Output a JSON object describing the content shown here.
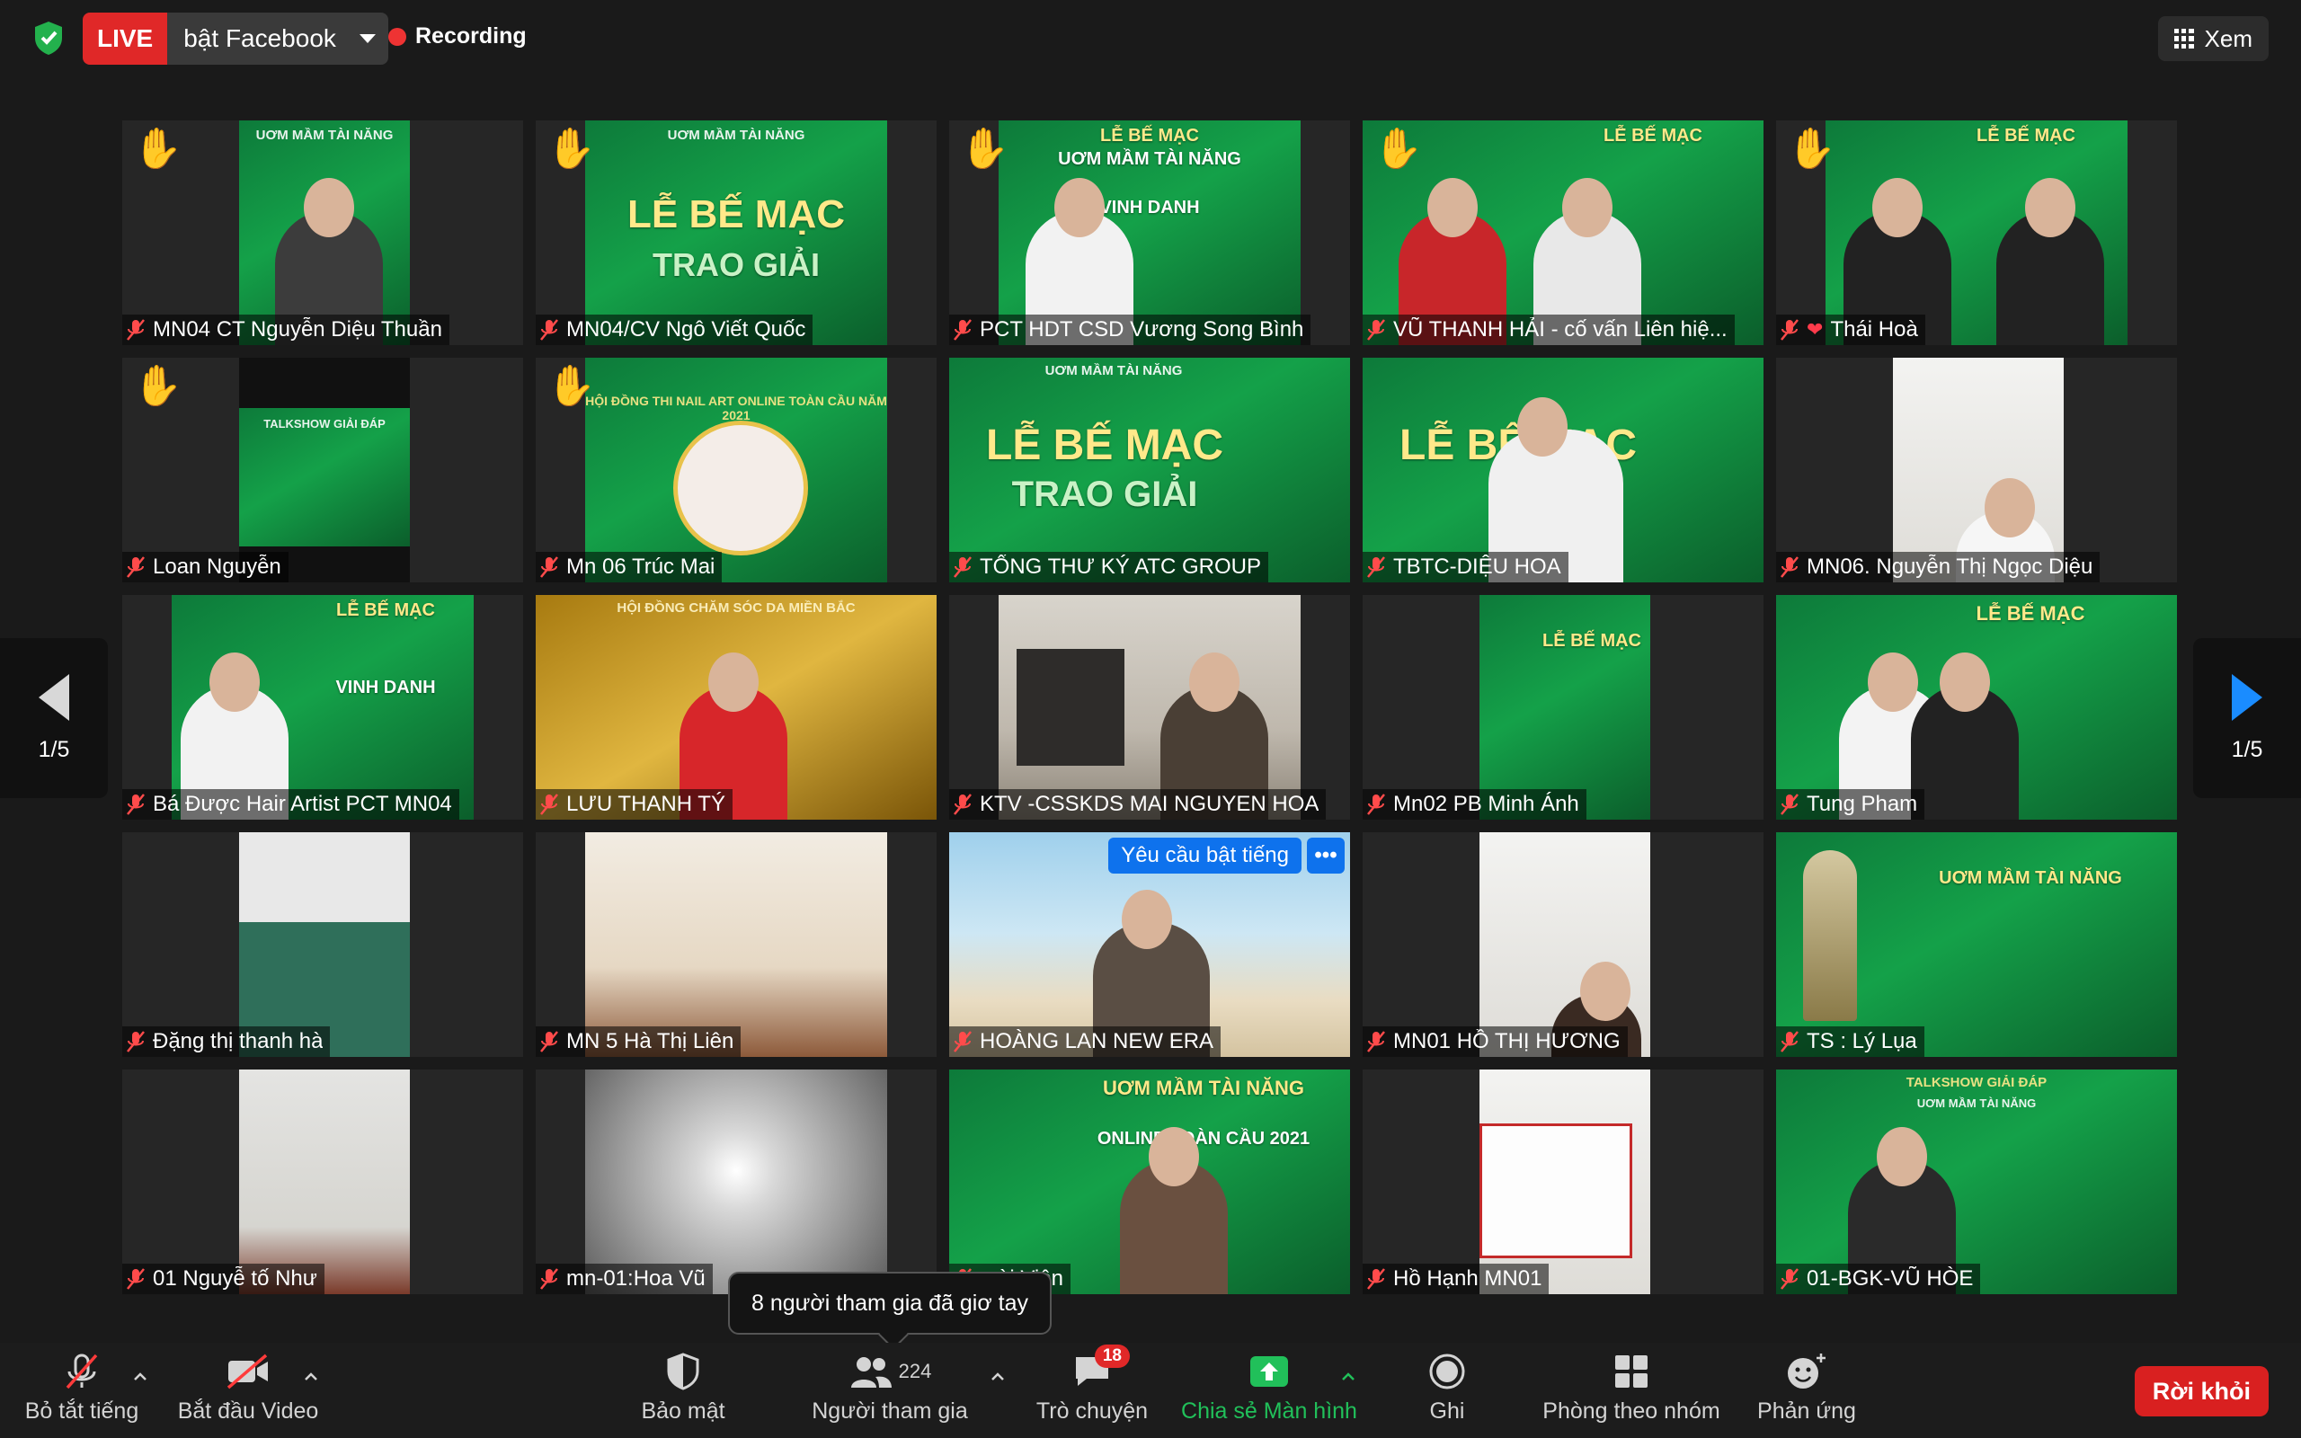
{
  "topbar": {
    "live_label": "LIVE",
    "live_destination": "bật Facebook",
    "recording_label": "Recording",
    "view_label": "Xem"
  },
  "colors": {
    "live": "#e02828",
    "accent": "#0e72ed",
    "share": "#21c05a",
    "leave": "#d92020"
  },
  "participants": [
    {
      "name": "MN04 CT Nguyễn Diệu Thuần",
      "hand": true
    },
    {
      "name": "MN04/CV Ngô Viết Quốc",
      "hand": true
    },
    {
      "name": "PCT HDT CSD Vương Song Bình",
      "hand": true
    },
    {
      "name": "VŨ THANH HẢI - cố vấn Liên hiệ...",
      "hand": true
    },
    {
      "name": "Thái Hoà",
      "hand": true,
      "heart": true
    },
    {
      "name": "Loan Nguyễn",
      "hand": true
    },
    {
      "name": "Mn 06 Trúc Mai",
      "hand": true
    },
    {
      "name": "TỔNG THƯ KÝ ATC GROUP",
      "hand": false
    },
    {
      "name": "TBTC-DIỆU HOA",
      "hand": false
    },
    {
      "name": "MN06. Nguyễn Thị Ngọc Diệu",
      "hand": false
    },
    {
      "name": "Bá Được Hair Artist PCT MN04",
      "hand": false
    },
    {
      "name": "LƯU THANH TÝ",
      "hand": false
    },
    {
      "name": "KTV -CSSKDS MAI NGUYEN HOA",
      "hand": false
    },
    {
      "name": "Mn02 PB Minh Ánh",
      "hand": false
    },
    {
      "name": "Tung Pham",
      "hand": false
    },
    {
      "name": "Đặng  thị  thanh hà",
      "hand": false
    },
    {
      "name": "MN 5 Hà Thị Liên",
      "hand": false
    },
    {
      "name": "HOÀNG LAN NEW ERA",
      "hand": false
    },
    {
      "name": "MN01 HỒ THỊ HƯƠNG",
      "hand": false
    },
    {
      "name": "TS : Lý Lụa",
      "hand": false
    },
    {
      "name": "01 Nguyễ tố Như",
      "hand": false
    },
    {
      "name": "mn-01:Hoa Vũ",
      "hand": false
    },
    {
      "name": "...ài Viên",
      "hand": false
    },
    {
      "name": "Hồ Hạnh MN01",
      "hand": false
    },
    {
      "name": "01-BGK-VŨ HÒE",
      "hand": false
    }
  ],
  "posters": {
    "le_be_mac": "LỄ BẾ MẠC",
    "uom_mam": "UƠM MẦM TÀI NĂNG",
    "trao_giai": "TRAO GIẢI",
    "vinh_danh": "VINH DANH",
    "talkshow": "TALKSHOW GIẢI ĐÁP",
    "online": "ONLINE TOÀN CẦU 2021",
    "hoi_dong_nail": "HỘI ĐỒNG THI NAIL ART ONLINE TOÀN CẦU NĂM 2021",
    "hoi_dong_da": "HỘI ĐỒNG CHĂM SÓC DA MIỀN BẮC"
  },
  "request_unmute": {
    "label": "Yêu cầu bật tiếng",
    "more": "•••"
  },
  "pager": {
    "left": "1/5",
    "right": "1/5"
  },
  "tooltip": "8 người tham gia đã giơ tay",
  "toolbar": {
    "mute": "Bỏ tắt tiếng",
    "video": "Bắt đầu Video",
    "security": "Bảo mật",
    "participants": "Người tham gia",
    "participants_count": "224",
    "chat": "Trò chuyện",
    "chat_badge": "18",
    "share": "Chia sẻ Màn hình",
    "record": "Ghi",
    "breakout": "Phòng theo nhóm",
    "reactions": "Phản ứng",
    "leave": "Rời khỏi"
  }
}
